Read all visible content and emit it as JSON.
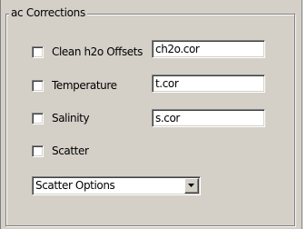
{
  "group": {
    "title": "ac Corrections"
  },
  "options": [
    {
      "label": "Clean h2o Offsets",
      "file_value": "ch2o.cor",
      "checked": false
    },
    {
      "label": "Temperature",
      "file_value": "t.cor",
      "checked": false
    },
    {
      "label": "Salinity",
      "file_value": "s.cor",
      "checked": false
    },
    {
      "label": "Scatter",
      "checked": false
    }
  ],
  "scatter_select": {
    "selected": "Scatter Options"
  },
  "colors": {
    "panel": "#d4d0c8",
    "shadow": "#808080",
    "highlight": "#ffffff"
  },
  "icons": {
    "dropdown": "chevron-down-icon"
  }
}
